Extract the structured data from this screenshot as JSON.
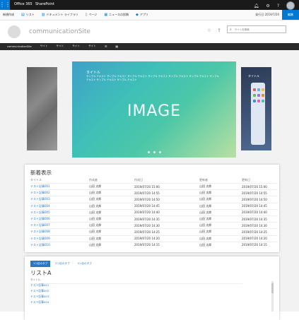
{
  "topbar": {
    "app_launcher_icon": "waffle-icon",
    "office": "Office 365",
    "product": "SharePoint",
    "icons": [
      "bell-icon",
      "gear-icon",
      "help-icon"
    ]
  },
  "commandbar": {
    "items": [
      {
        "icon": "plus-icon",
        "label": "新規作成"
      },
      {
        "icon": "list-icon",
        "label": "リスト"
      },
      {
        "icon": "library-icon",
        "label": "ドキュメント ライブラリ"
      },
      {
        "icon": "page-icon",
        "label": "ページ"
      },
      {
        "icon": "news-icon",
        "label": "ニュースの投稿"
      },
      {
        "icon": "app-icon",
        "label": "アプリ"
      }
    ],
    "right_text": "発行日 2019/7/20",
    "edit_label": "編集"
  },
  "site": {
    "title": "communicationSite",
    "search_placeholder": "サイトを検索",
    "icons": [
      "star-icon",
      "share-icon"
    ]
  },
  "nav": {
    "items": [
      "communicationSite",
      "サイト",
      "サイト",
      "サイト",
      "サイト"
    ]
  },
  "carousel": {
    "main_title": "タイトル",
    "main_body": "サンプル テキスト サンプル テキスト サンプル テキスト サンプル テキスト サンプル テキスト サンプル テキスト サンプル テキスト サンプル テキスト サンプル テキスト",
    "image_label": "IMAGE",
    "right_title": "タイトル",
    "dot_count": 3
  },
  "news": {
    "title": "新着表示",
    "columns": [
      "タイトル",
      "作成者",
      "作成日",
      "更新者",
      "更新日"
    ],
    "rows": [
      [
        "テスト記事001",
        "山田 太郎",
        "2019/07/20 15:00",
        "山田 太郎",
        "2019/07/20 15:00"
      ],
      [
        "テスト記事002",
        "山田 太郎",
        "2019/07/20 14:55",
        "山田 太郎",
        "2019/07/20 14:55"
      ],
      [
        "テスト記事003",
        "山田 太郎",
        "2019/07/20 14:50",
        "山田 太郎",
        "2019/07/20 14:50"
      ],
      [
        "テスト記事004",
        "山田 太郎",
        "2019/07/20 14:45",
        "山田 太郎",
        "2019/07/20 14:45"
      ],
      [
        "テスト記事005",
        "山田 太郎",
        "2019/07/20 14:40",
        "山田 太郎",
        "2019/07/20 14:40"
      ],
      [
        "テスト記事006",
        "山田 太郎",
        "2019/07/20 14:35",
        "山田 太郎",
        "2019/07/20 14:35"
      ],
      [
        "テスト記事007",
        "山田 太郎",
        "2019/07/20 14:30",
        "山田 太郎",
        "2019/07/20 14:30"
      ],
      [
        "テスト記事008",
        "山田 太郎",
        "2019/07/20 14:25",
        "山田 太郎",
        "2019/07/20 14:25"
      ],
      [
        "テスト記事009",
        "山田 太郎",
        "2019/07/20 14:20",
        "山田 太郎",
        "2019/07/20 14:20"
      ],
      [
        "テスト記事010",
        "山田 太郎",
        "2019/07/20 14:15",
        "山田 太郎",
        "2019/07/20 14:15"
      ]
    ]
  },
  "tabs": {
    "items": [
      "1つ目のタブ",
      "2つ目のタブ",
      "3つ目のタブ"
    ]
  },
  "listA": {
    "title": "リストA",
    "column": "タイトル",
    "items": [
      "テスト記事001",
      "テスト記事002",
      "テスト記事003",
      "テスト記事004"
    ]
  }
}
